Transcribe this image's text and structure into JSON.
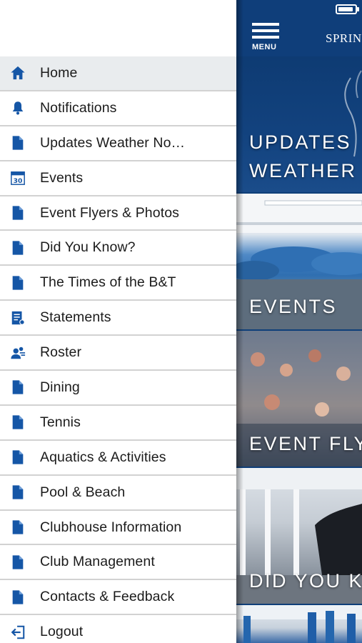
{
  "drawer": {
    "items": [
      {
        "label": "Home",
        "icon": "home-icon"
      },
      {
        "label": "Notifications",
        "icon": "bell-icon"
      },
      {
        "label": "Updates Weather   No…",
        "icon": "page-icon"
      },
      {
        "label": "Events",
        "icon": "calendar-icon",
        "calendar_day": "30"
      },
      {
        "label": "Event Flyers & Photos",
        "icon": "page-icon"
      },
      {
        "label": "Did You Know?",
        "icon": "page-icon"
      },
      {
        "label": "The Times of the B&T",
        "icon": "page-icon"
      },
      {
        "label": "Statements",
        "icon": "statement-icon"
      },
      {
        "label": "Roster",
        "icon": "roster-icon"
      },
      {
        "label": "Dining",
        "icon": "page-icon"
      },
      {
        "label": "Tennis",
        "icon": "page-icon"
      },
      {
        "label": "Aquatics & Activities",
        "icon": "page-icon"
      },
      {
        "label": "Pool & Beach",
        "icon": "page-icon"
      },
      {
        "label": "Clubhouse Information",
        "icon": "page-icon"
      },
      {
        "label": "Club Management",
        "icon": "page-icon"
      },
      {
        "label": "Contacts & Feedback",
        "icon": "page-icon"
      },
      {
        "label": "Logout",
        "icon": "logout-icon"
      }
    ],
    "active_index": 0
  },
  "main": {
    "menu_label": "MENU",
    "title": "SPRIN",
    "tiles": [
      {
        "line1": "UPDATES",
        "line2": "WEATHER"
      },
      {
        "line1": "EVENTS"
      },
      {
        "line1": "EVENT FLY"
      },
      {
        "line1": "DID YOU K"
      }
    ]
  },
  "colors": {
    "icon_blue": "#1556a6",
    "header_blue": "#0f3e7a",
    "active_row": "#e9ecee",
    "divider": "#d2d2d2"
  }
}
